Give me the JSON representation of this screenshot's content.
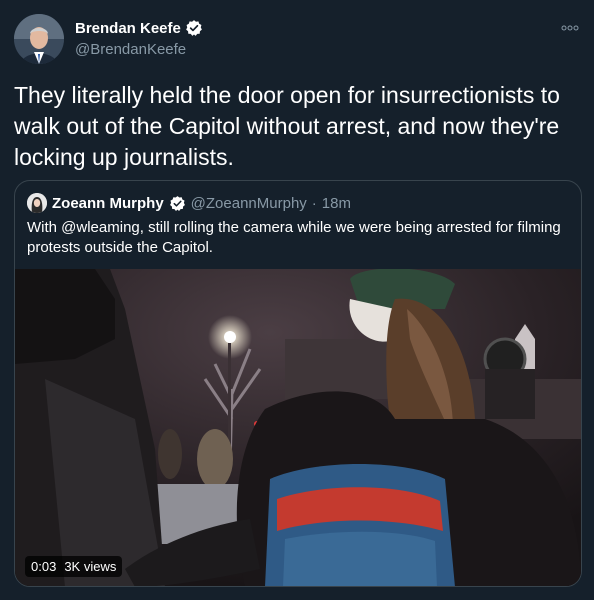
{
  "tweet": {
    "author_name": "Brendan Keefe",
    "author_handle": "@BrendanKeefe",
    "text": "They literally held the door open for insurrectionists to walk out of the Capitol without arrest, and now they're locking up journalists."
  },
  "quote": {
    "author_name": "Zoeann Murphy",
    "author_handle": "@ZoeannMurphy",
    "separator": "·",
    "time": "18m",
    "text": "With @wleaming, still rolling the camera while we were being arrested for filming protests outside the Capitol.",
    "video": {
      "duration": "0:03",
      "views": "3K views"
    }
  },
  "colors": {
    "background": "#15202b",
    "secondary_text": "#8899a6",
    "border": "#38444d",
    "verified": "#ffffff"
  },
  "icons": {
    "verified": "verified-badge-icon",
    "more": "more-options-icon"
  }
}
